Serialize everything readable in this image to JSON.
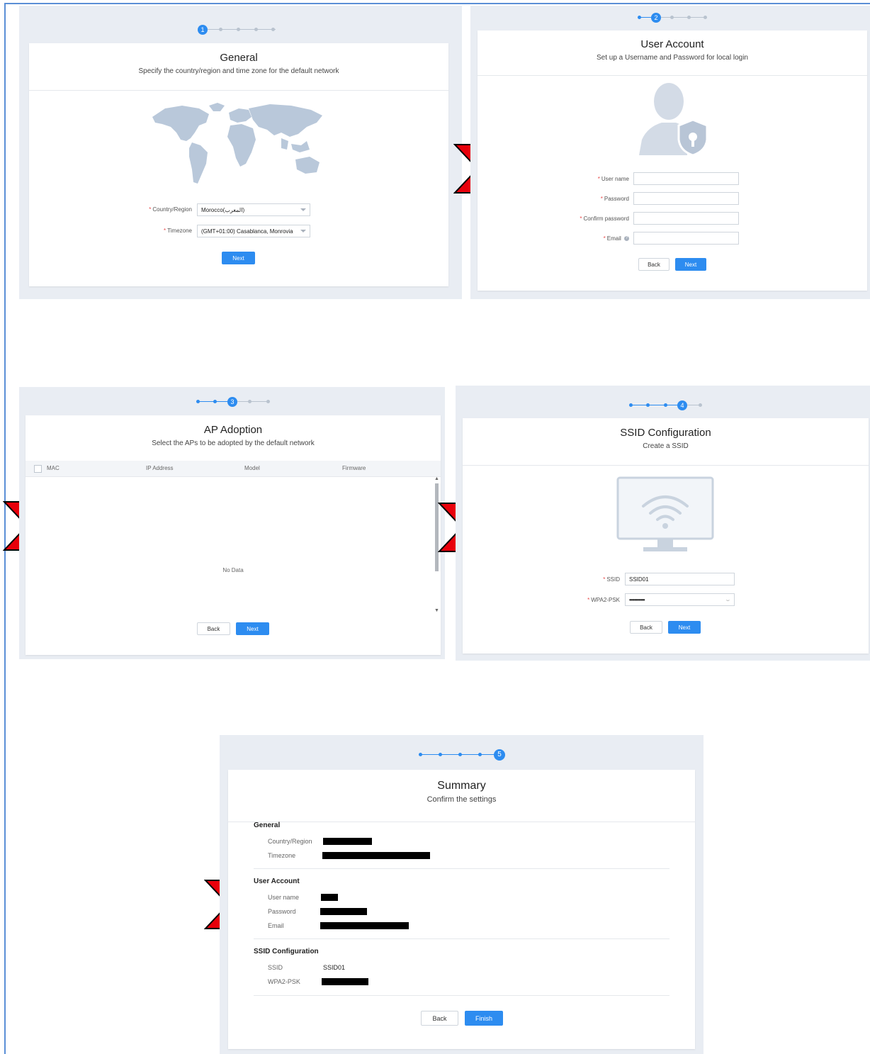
{
  "steps": {
    "one": "1",
    "two": "2",
    "three": "3",
    "four": "4",
    "five": "5"
  },
  "general": {
    "title": "General",
    "subtitle": "Specify the country/region and time zone for the default network",
    "country_label": "Country/Region",
    "country_value": "Morocco(المغرب)",
    "timezone_label": "Timezone",
    "timezone_value": "(GMT+01:00) Casablanca, Monrovia",
    "next_label": "Next"
  },
  "user_account": {
    "title": "User Account",
    "subtitle": "Set up a Username and Password for local login",
    "username_label": "User name",
    "password_label": "Password",
    "confirm_label": "Confirm password",
    "email_label": "Email",
    "back_label": "Back",
    "next_label": "Next"
  },
  "ap_adoption": {
    "title": "AP Adoption",
    "subtitle": "Select the APs to be adopted by the default network",
    "columns": [
      "MAC",
      "IP Address",
      "Model",
      "Firmware"
    ],
    "empty_text": "No Data",
    "back_label": "Back",
    "next_label": "Next"
  },
  "ssid": {
    "title": "SSID Configuration",
    "subtitle": "Create a SSID",
    "ssid_label": "SSID",
    "ssid_value": "SSID01",
    "psk_label": "WPA2-PSK",
    "psk_value": "••••••••••••",
    "back_label": "Back",
    "next_label": "Next"
  },
  "summary": {
    "title": "Summary",
    "subtitle": "Confirm the settings",
    "general_heading": "General",
    "country_label": "Country/Region",
    "timezone_label": "Timezone",
    "user_heading": "User Account",
    "username_label": "User name",
    "password_label": "Password",
    "email_label": "Email",
    "ssid_heading": "SSID Configuration",
    "ssid_label": "SSID",
    "ssid_value": "SSID01",
    "psk_label": "WPA2-PSK",
    "back_label": "Back",
    "finish_label": "Finish"
  },
  "colors": {
    "accent": "#2d8cf0",
    "arrow": "#e8000b",
    "panel": "#e9edf3"
  }
}
